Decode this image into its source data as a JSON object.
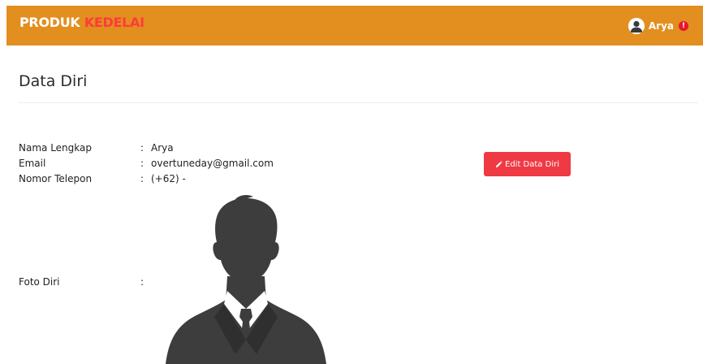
{
  "navbar": {
    "brand_part1": "PRODUK",
    "brand_part2": "KEDELAI",
    "user_name": "Arya",
    "alert_symbol": "!",
    "avatar_icon": "user-avatar-icon",
    "alert_icon": "exclamation-circle-icon"
  },
  "page": {
    "title": "Data Diri"
  },
  "profile": {
    "fields": [
      {
        "label": "Nama Lengkap",
        "separator": ":",
        "value": "Arya"
      },
      {
        "label": "Email",
        "separator": ":",
        "value": "overtuneday@gmail.com"
      },
      {
        "label": "Nomor Telepon",
        "separator": ":",
        "value": "(+62) -"
      },
      {
        "label": "Foto Diri",
        "separator": ":",
        "value": ""
      }
    ],
    "photo_icon": "default-profile-silhouette"
  },
  "actions": {
    "edit_label": "Edit Data Diri",
    "edit_icon": "pencil-icon"
  },
  "colors": {
    "navbar_bg": "#e28f1f",
    "brand_accent": "#ff3b3b",
    "edit_button_bg": "#ef3a44",
    "alert_badge": "#e8162b"
  }
}
